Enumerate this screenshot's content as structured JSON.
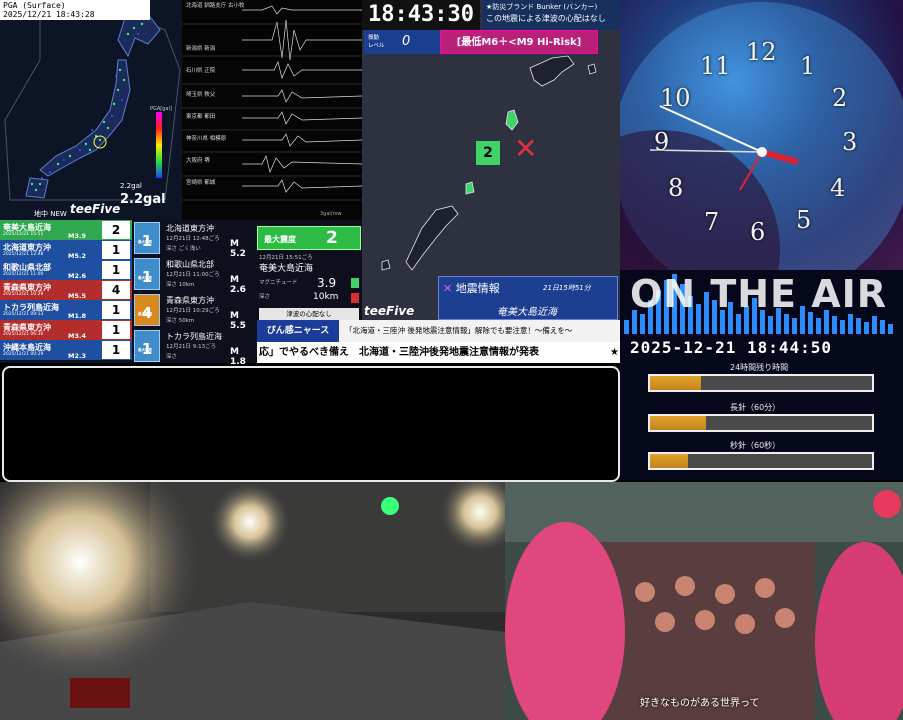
{
  "pga": {
    "header_line1": "PGA (Surface)",
    "header_line2": "2025/12/21 18:43:28",
    "scale_label": "PGA[gal]",
    "gal_small": "2.2gal",
    "gal_big": "2.2gal",
    "brand": "teeFive",
    "now_label": "地中 NEW"
  },
  "waveforms": {
    "stations": [
      "北海道 釧路支庁 古小牧",
      "新潟県 新潟",
      "石川県 正院",
      "埼玉県 秩父",
      "東京都 都田",
      "神奈川県 相模原",
      "大阪府 堺",
      "宮崎県 都城"
    ],
    "unit": "3gal/row"
  },
  "epicenter": {
    "clock": "18:43:30",
    "tsunami_line1": "★防災ブランド Bunker (バンカー)",
    "tsunami_line2": "この地震による津波の心配はなし",
    "level_label1": "振動",
    "level_label2": "レベル",
    "level_value": "0",
    "risk_banner": "[最低M6＋<M9 Hi-Risk]",
    "pin_value": "2",
    "info_title": "地震情報",
    "info_time": "21日15時51分",
    "info_region": "奄美大島近海",
    "brand": "teeFive",
    "help": "ぴん感ニャース"
  },
  "quake_list": [
    {
      "name": "奄美大島近海",
      "date": "2025/12/21 15:51",
      "mag": "M3.9",
      "intensity": "2",
      "color": "#2fa84f"
    },
    {
      "name": "北海道東方沖",
      "date": "2025/12/21 12:48",
      "mag": "M5.2",
      "intensity": "1",
      "color": "#1e4fa0"
    },
    {
      "name": "和歌山県北部",
      "date": "2025/12/21 11:00",
      "mag": "M2.6",
      "intensity": "1",
      "color": "#1e4fa0"
    },
    {
      "name": "青森県東方沖",
      "date": "2025/12/21 10:29",
      "mag": "M5.5",
      "intensity": "4",
      "color": "#b32d2d"
    },
    {
      "name": "トカラ列島近海",
      "date": "2025/12/21 09:13",
      "mag": "M1.8",
      "intensity": "1",
      "color": "#1e4fa0"
    },
    {
      "name": "青森県東方沖",
      "date": "2025/12/21 06:30",
      "mag": "M3.4",
      "intensity": "1",
      "color": "#b32d2d"
    },
    {
      "name": "沖縄本島近海",
      "date": "2025/12/21 00:29",
      "mag": "M2.3",
      "intensity": "1",
      "color": "#1e4fa0"
    }
  ],
  "quake_detail": [
    {
      "badge": "1",
      "name": "北海道東方沖",
      "date": "12月21日 12:48ごろ",
      "depth": "深さ ごく浅い",
      "mag": "M 5.2",
      "badge_color": "#3e8cc8"
    },
    {
      "badge": "1",
      "name": "和歌山県北部",
      "date": "12月21日 11:00ごろ",
      "depth": "深さ 10km",
      "mag": "M 2.6",
      "badge_color": "#3e8cc8"
    },
    {
      "badge": "4",
      "name": "青森県東方沖",
      "date": "12月21日 10:29ごろ",
      "depth": "深さ 50km",
      "mag": "M 5.5",
      "badge_color": "#d88a1f"
    },
    {
      "badge": "1",
      "name": "トカラ列島近海",
      "date": "12月21日 9:13ごろ",
      "depth": "深さ",
      "mag": "M 1.8",
      "badge_color": "#3e8cc8"
    }
  ],
  "badge_label": "最大震度",
  "summary": {
    "max_label": "最大震度",
    "max_value": "2",
    "date": "12月21日 15:51ごろ",
    "region": "奄美大島近海",
    "mag_label": "マグニチュード",
    "mag_value": "3.9",
    "depth_label": "深さ",
    "depth_value": "10km",
    "no_tsunami": "津波の心配なし"
  },
  "news": {
    "tag": "ぴん感ニャース",
    "title": "「北海道・三陸沖 後発地震注意情報」解除でも要注意！〜備えを〜",
    "ticker": "応」でやるべき備え　北海道・三陸沖後発地震注意情報が発表",
    "star": "★"
  },
  "clock_face": {
    "numbers": [
      "12",
      "1",
      "2",
      "3",
      "4",
      "5",
      "6",
      "7",
      "8",
      "9",
      "10",
      "11"
    ]
  },
  "on_air": {
    "text": "ON THE AIR",
    "datetime": "2025-12-21 18:44:50",
    "bars": [
      {
        "label": "24時間残り時間",
        "fraction": 0.23
      },
      {
        "label": "長針（60分）",
        "fraction": 0.25
      },
      {
        "label": "秒針（60秒）",
        "fraction": 0.17
      }
    ]
  },
  "live_cam": {
    "caption": "好きなものがある世界って"
  }
}
